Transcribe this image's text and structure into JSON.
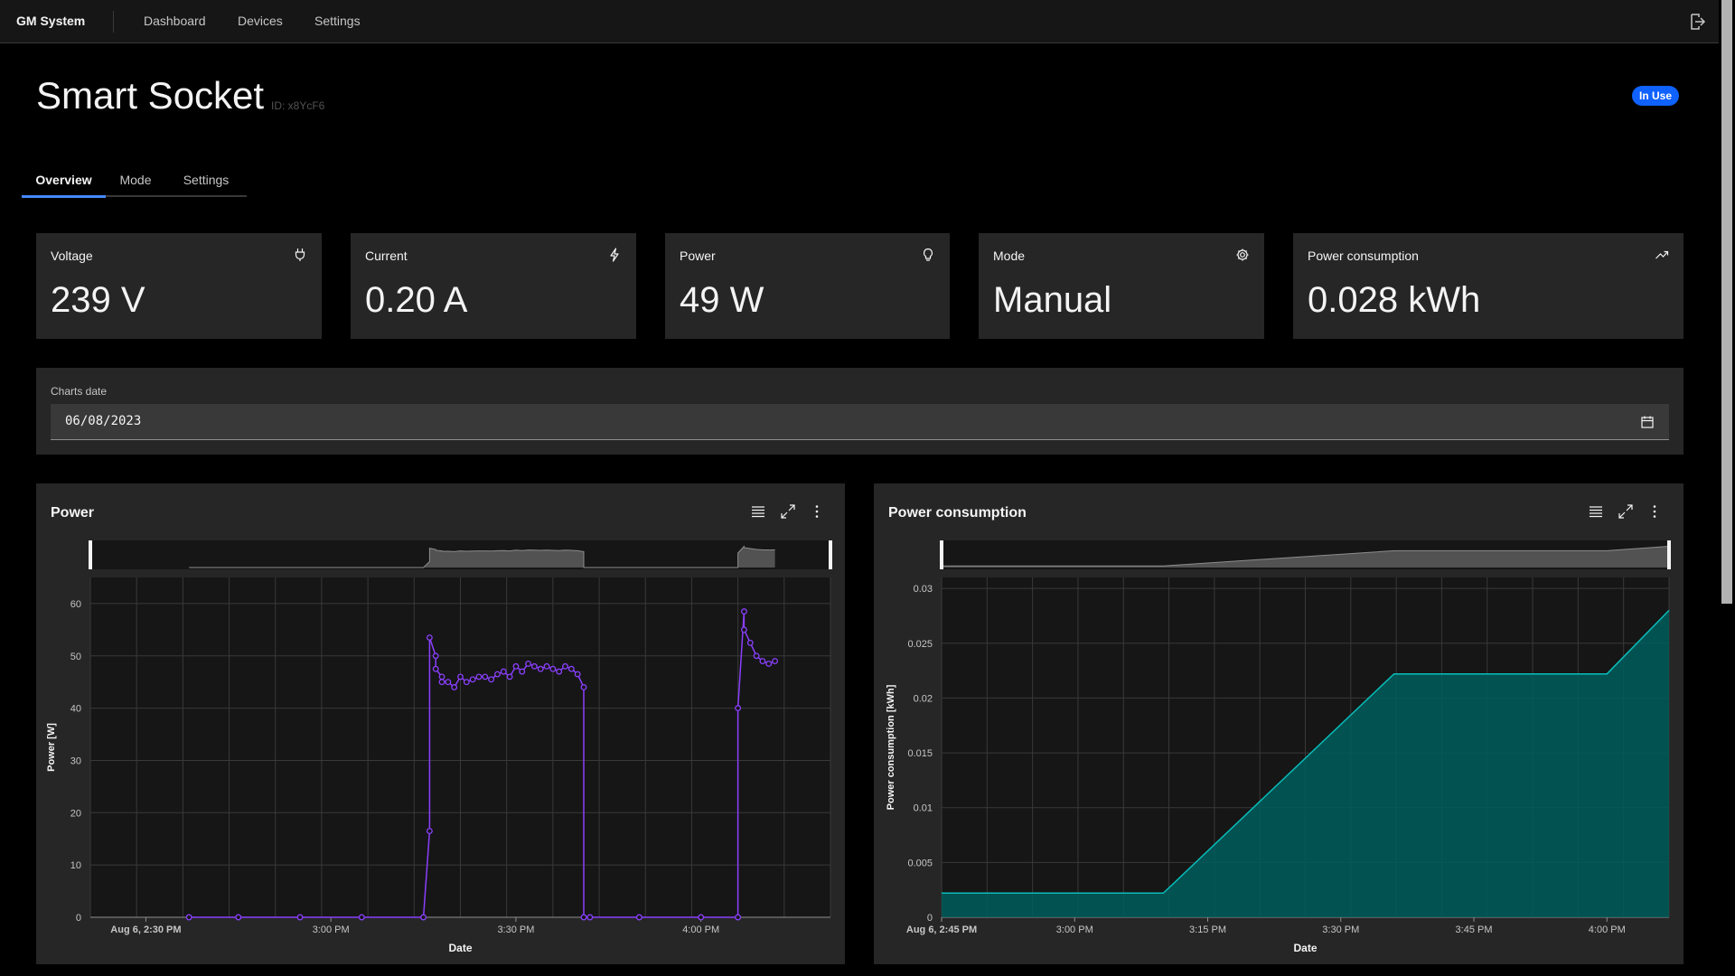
{
  "header": {
    "brand": "GM System",
    "nav": [
      "Dashboard",
      "Devices",
      "Settings"
    ]
  },
  "device": {
    "name": "Smart Socket",
    "id_text": "ID: x8YcF6",
    "status": "In Use"
  },
  "tabs": [
    "Overview",
    "Mode",
    "Settings"
  ],
  "cards": [
    {
      "title": "Voltage",
      "value": "239 V",
      "icon": "plug-icon"
    },
    {
      "title": "Current",
      "value": "0.20 A",
      "icon": "flash-icon"
    },
    {
      "title": "Power",
      "value": "49 W",
      "icon": "bulb-icon"
    },
    {
      "title": "Mode",
      "value": "Manual",
      "icon": "gear-icon"
    },
    {
      "title": "Power consumption",
      "value": "0.028 kWh",
      "icon": "trend-up-icon"
    }
  ],
  "date_picker": {
    "label": "Charts date",
    "value": "06/08/2023"
  },
  "colors": {
    "accent": "#4589ff",
    "badge": "#0f62fe",
    "power_line": "#8a3ffc",
    "consumption_fill": "#005d5d",
    "consumption_line": "#08bdba"
  },
  "chart_data": [
    {
      "type": "line",
      "title": "Power",
      "xlabel": "Date",
      "ylabel": "Power [W]",
      "ylim": [
        0,
        65
      ],
      "yticks": [
        0,
        10,
        20,
        30,
        40,
        50,
        60
      ],
      "xticks": [
        "Aug 6, 2:30 PM",
        "3:00 PM",
        "3:30 PM",
        "4:00 PM"
      ],
      "xlim": [
        "2:21 PM",
        "4:21 PM"
      ],
      "grid": true,
      "marker": "circle",
      "x": [
        "2:37 PM",
        "2:45 PM",
        "2:55 PM",
        "3:05 PM",
        "3:15 PM",
        "3:16 PM",
        "3:16 PM",
        "3:17 PM",
        "3:17 PM",
        "3:18 PM",
        "3:18 PM",
        "3:19 PM",
        "3:20 PM",
        "3:21 PM",
        "3:22 PM",
        "3:23 PM",
        "3:24 PM",
        "3:25 PM",
        "3:26 PM",
        "3:27 PM",
        "3:28 PM",
        "3:29 PM",
        "3:30 PM",
        "3:31 PM",
        "3:32 PM",
        "3:33 PM",
        "3:34 PM",
        "3:35 PM",
        "3:36 PM",
        "3:37 PM",
        "3:38 PM",
        "3:39 PM",
        "3:40 PM",
        "3:41 PM",
        "3:41 PM",
        "3:42 PM",
        "3:50 PM",
        "4:00 PM",
        "4:06 PM",
        "4:06 PM",
        "4:07 PM",
        "4:07 PM",
        "4:08 PM",
        "4:09 PM",
        "4:10 PM",
        "4:11 PM",
        "4:12 PM"
      ],
      "y": [
        0,
        0,
        0,
        0,
        0,
        16.5,
        53.5,
        50,
        47.5,
        46,
        45,
        45,
        44,
        46,
        45,
        45.5,
        46,
        46,
        45.5,
        46.5,
        47,
        46,
        48,
        47,
        48.5,
        48,
        47.5,
        48,
        47.5,
        47,
        48,
        47.5,
        46.5,
        44,
        0,
        0,
        0,
        0,
        0,
        40,
        58.5,
        55,
        52.5,
        50,
        49,
        48.5,
        49
      ]
    },
    {
      "type": "area",
      "title": "Power consumption",
      "xlabel": "Date",
      "ylabel": "Power consumption [kWh]",
      "ylim": [
        0,
        0.031
      ],
      "yticks": [
        0,
        0.005,
        0.01,
        0.015,
        0.02,
        0.025,
        0.03
      ],
      "xticks": [
        "Aug 6, 2:45 PM",
        "3:00 PM",
        "3:15 PM",
        "3:30 PM",
        "3:45 PM",
        "4:00 PM"
      ],
      "xlim": [
        "2:45 PM",
        "4:07 PM"
      ],
      "grid": true,
      "x": [
        "2:45 PM",
        "3:10 PM",
        "3:36 PM",
        "4:00 PM",
        "4:07 PM"
      ],
      "y": [
        0.0022,
        0.0022,
        0.0222,
        0.0222,
        0.028
      ]
    }
  ]
}
